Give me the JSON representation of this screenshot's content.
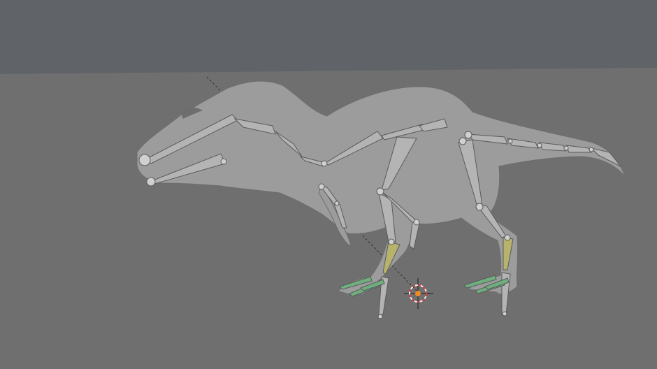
{
  "viewport": {
    "background_top": "#606468",
    "background_floor": "#6f6f6f",
    "mesh_color": "#9c9c9c",
    "mesh_shadow": "#6e6e6e",
    "bone_fill": "#b4b4b4",
    "bone_stroke": "#5a5a5a",
    "bone_joint": "#d0d0d0",
    "ik_bone_fill": "#b6b46c",
    "toe_bone_fill": "#6fae7e",
    "cursor_ring_red": "#d83a3a",
    "cursor_ring_white": "#f2f2f2",
    "cursor_center": "#f08a24",
    "axis_line_color": "#2e2e2e",
    "icons": [
      "armature-icon",
      "3d-cursor-icon"
    ]
  }
}
